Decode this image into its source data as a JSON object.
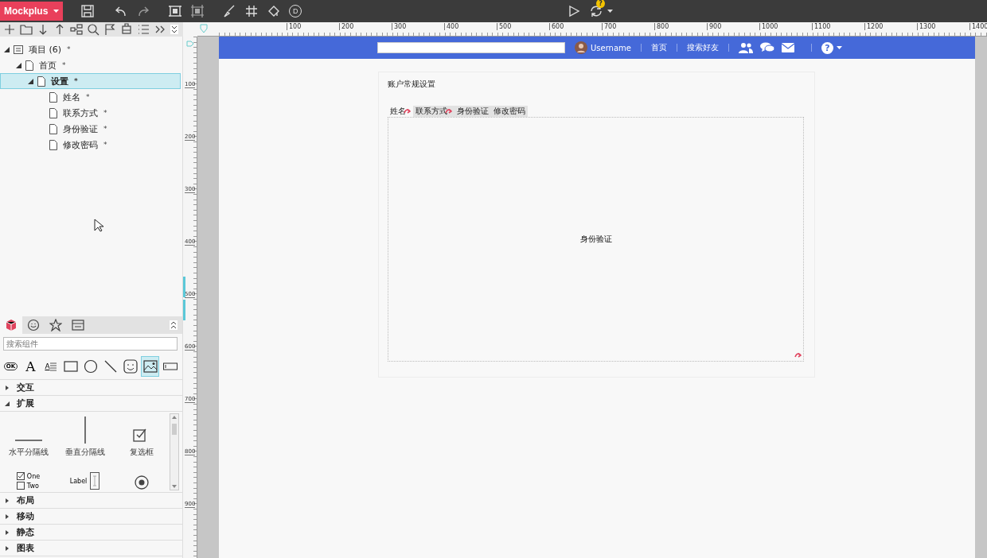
{
  "toolbar": {
    "app_button": "Mockplus",
    "d_button": "D",
    "sync_badge": "?"
  },
  "project_tree": [
    {
      "kind": "project",
      "label": "项目 (6)",
      "mark": "*",
      "expanded": true,
      "selected": false,
      "children": [
        {
          "kind": "page",
          "label": "首页",
          "mark": "*",
          "expanded": true,
          "selected": false,
          "children": [
            {
              "kind": "page",
              "label": "设置",
              "mark": "*",
              "expanded": true,
              "selected": true,
              "children": [
                {
                  "kind": "page",
                  "label": "姓名",
                  "mark": "*",
                  "selected": false
                },
                {
                  "kind": "page",
                  "label": "联系方式",
                  "mark": "*",
                  "selected": false
                },
                {
                  "kind": "page",
                  "label": "身份验证",
                  "mark": "*",
                  "selected": false
                },
                {
                  "kind": "page",
                  "label": "修改密码",
                  "mark": "*",
                  "selected": false
                }
              ]
            }
          ]
        }
      ]
    }
  ],
  "component_panel": {
    "tabs": [
      {
        "kind": "cube",
        "selected": true
      },
      {
        "kind": "smiley",
        "selected": false
      },
      {
        "kind": "star",
        "selected": false
      },
      {
        "kind": "window",
        "selected": false
      }
    ],
    "search": {
      "placeholder": "搜索组件"
    },
    "tools": [
      {
        "kind": "button",
        "text": "OK",
        "selected": false
      },
      {
        "kind": "text",
        "text": "A",
        "selected": false
      },
      {
        "kind": "paragraph",
        "text": "A",
        "selected": false
      },
      {
        "kind": "rect",
        "selected": false
      },
      {
        "kind": "circle",
        "selected": false
      },
      {
        "kind": "line",
        "selected": false
      },
      {
        "kind": "smiley",
        "selected": false
      },
      {
        "kind": "image",
        "selected": true
      },
      {
        "kind": "input",
        "selected": false
      }
    ],
    "sections": [
      {
        "label": "交互",
        "expanded": false
      },
      {
        "label": "扩展",
        "expanded": true,
        "items": [
          {
            "kind": "hline",
            "label": "水平分隔线"
          },
          {
            "kind": "vline",
            "label": "垂直分隔线"
          },
          {
            "kind": "checkbox",
            "label": "复选框"
          },
          {
            "kind": "checkgroup",
            "options": [
              "One",
              "Two"
            ]
          },
          {
            "kind": "labelinput",
            "text": "Label"
          },
          {
            "kind": "radio"
          }
        ]
      },
      {
        "label": "布局",
        "expanded": false
      },
      {
        "label": "移动",
        "expanded": false
      },
      {
        "label": "静态",
        "expanded": false
      },
      {
        "label": "图表",
        "expanded": false
      }
    ]
  },
  "rulers": {
    "horizontal": [
      "100",
      "200",
      "300",
      "400",
      "500",
      "600",
      "700",
      "800",
      "900",
      "1000",
      "1100",
      "1200",
      "1300",
      "1400"
    ],
    "vertical": [
      "100",
      "200",
      "300",
      "400",
      "500",
      "600",
      "700",
      "800",
      "900"
    ]
  },
  "artboard": {
    "header": {
      "username": "Username",
      "links": [
        "首页",
        "搜索好友"
      ],
      "help": "?"
    },
    "title": "账户常规设置",
    "tabs": [
      {
        "label": "姓名",
        "selected": true,
        "linked": true
      },
      {
        "label": "联系方式",
        "selected": false,
        "linked": true
      },
      {
        "label": "身份验证",
        "selected": false,
        "linked": false
      },
      {
        "label": "修改密码",
        "selected": false,
        "linked": false
      }
    ],
    "panel_text": "身份验证",
    "panel_linked": true
  }
}
